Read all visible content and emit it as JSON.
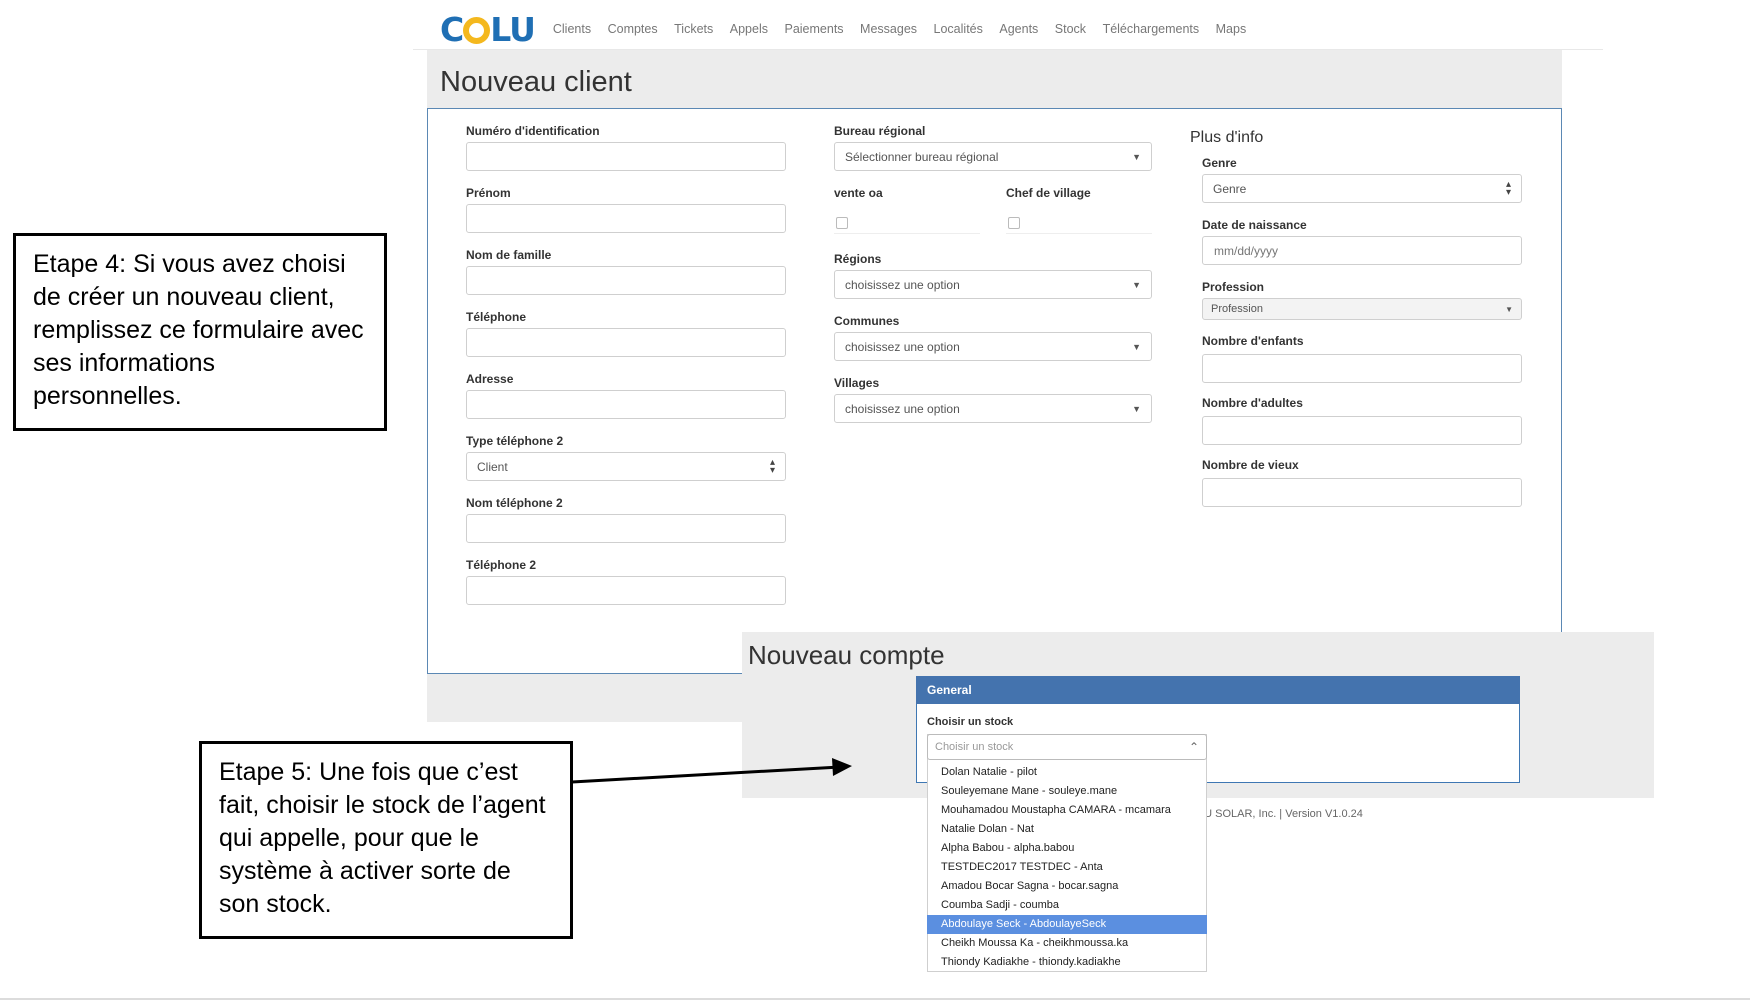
{
  "nav": {
    "logo_left": "C",
    "logo_right": "LU",
    "links": [
      "Clients",
      "Comptes",
      "Tickets",
      "Appels",
      "Paiements",
      "Messages",
      "Localités",
      "Agents",
      "Stock",
      "Téléchargements",
      "Maps"
    ]
  },
  "client_form": {
    "title": "Nouveau client",
    "col1": {
      "id_label": "Numéro d'identification",
      "firstname_label": "Prénom",
      "lastname_label": "Nom de famille",
      "phone_label": "Téléphone",
      "address_label": "Adresse",
      "phone2_type_label": "Type téléphone 2",
      "phone2_type_value": "Client",
      "phone2_name_label": "Nom téléphone 2",
      "phone2_label": "Téléphone 2"
    },
    "col2": {
      "office_label": "Bureau régional",
      "office_value": "Sélectionner bureau régional",
      "vente_label": "vente oa",
      "chef_label": "Chef de village",
      "regions_label": "Régions",
      "regions_value": "choisissez une option",
      "communes_label": "Communes",
      "communes_value": "choisissez une option",
      "villages_label": "Villages",
      "villages_value": "choisissez une option"
    },
    "col3": {
      "section_title": "Plus d'info",
      "genre_label": "Genre",
      "genre_value": "Genre",
      "dob_label": "Date de naissance",
      "dob_placeholder": "mm/dd/yyyy",
      "profession_label": "Profession",
      "profession_value": "Profession",
      "children_label": "Nombre d'enfants",
      "adults_label": "Nombre d'adultes",
      "elders_label": "Nombre de vieux"
    }
  },
  "compte_form": {
    "title": "Nouveau compte",
    "panel_title": "General",
    "stock_label": "Choisir un stock",
    "stock_placeholder": "Choisir un stock",
    "stock_options": [
      "Dolan Natalie - pilot",
      "Souleyemane Mane - souleye.mane",
      "Mouhamadou Moustapha CAMARA - mcamara",
      "Natalie Dolan - Nat",
      "Alpha Babou - alpha.babou",
      "TESTDEC2017 TESTDEC - Anta",
      "Amadou Bocar Sagna - bocar.sagna",
      "Coumba Sadji - coumba",
      "Abdoulaye Seck - AbdoulayeSeck",
      "Cheikh Moussa Ka - cheikhmoussa.ka",
      "Thiondy Kadiakhe - thiondy.kadiakhe"
    ],
    "selected_option": "Abdoulaye Seck - AbdoulayeSeck",
    "footer": "LU SOLAR, Inc. | Version V1.0.24"
  },
  "annotations": {
    "step4": "Etape 4: Si vous avez choisi de créer un nouveau client, remplissez ce formulaire avec ses informations personnelles.",
    "step5": "Etape 5: Une fois que c’est fait, choisir le stock de l’agent qui appelle, pour que le système à activer sorte de son stock."
  },
  "colors": {
    "brand_blue": "#1f6fb4",
    "brand_sun": "#f4b81e",
    "panel_blue": "#4473ae",
    "selected": "#5b8fe0"
  }
}
